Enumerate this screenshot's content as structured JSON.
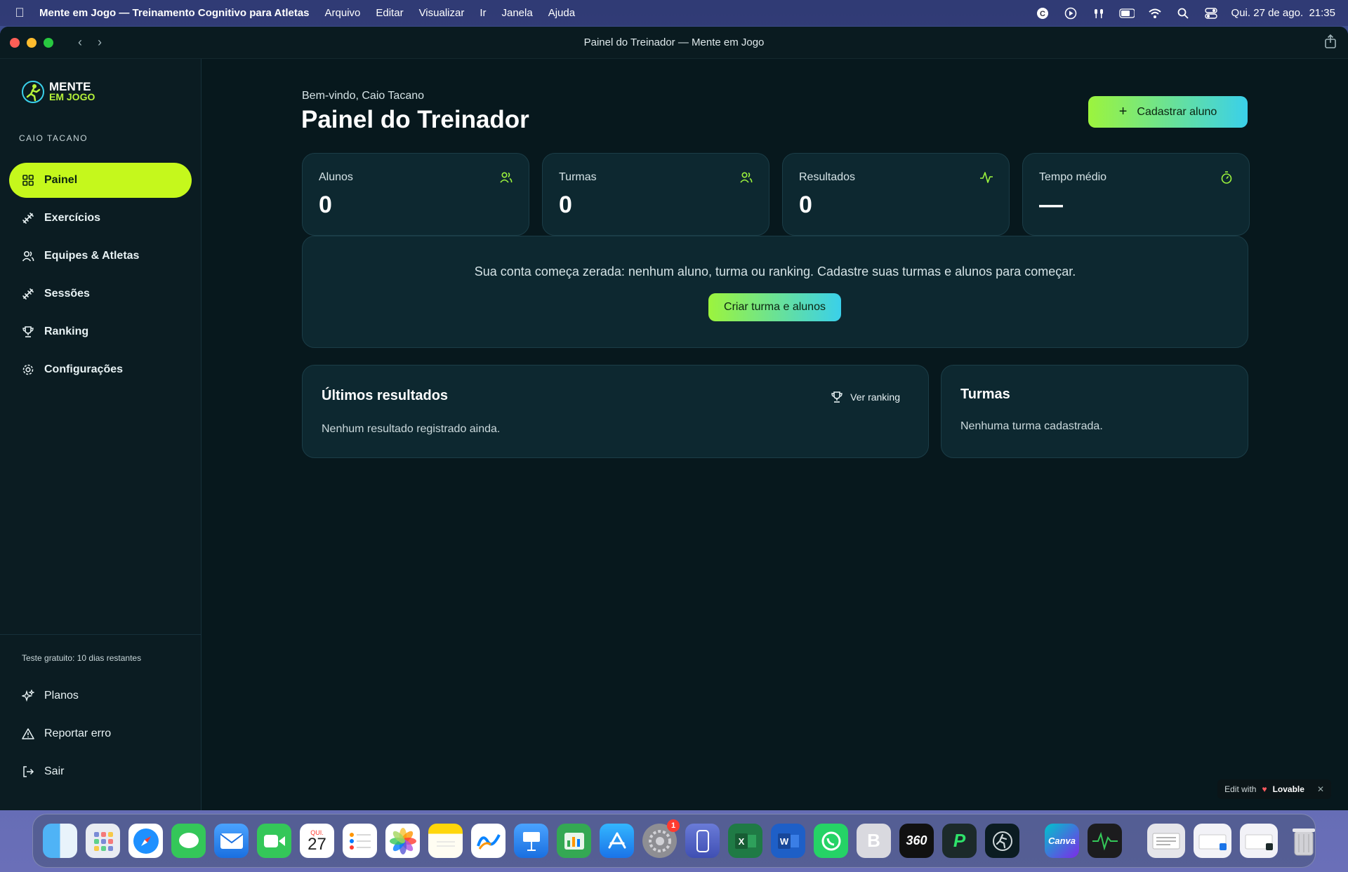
{
  "menubar": {
    "app_name": "Mente em Jogo — Treinamento Cognitivo para Atletas",
    "items": [
      "Arquivo",
      "Editar",
      "Visualizar",
      "Ir",
      "Janela",
      "Ajuda"
    ],
    "datetime": "Qui. 27 de ago.  21:35"
  },
  "window": {
    "title": "Painel do Treinador — Mente em Jogo"
  },
  "sidebar": {
    "brand_top": "MENTE",
    "brand_bottom": "EM JOGO",
    "coach": "CAIO TACANO",
    "items": [
      {
        "label": "Painel",
        "icon": "grid-icon"
      },
      {
        "label": "Exercícios",
        "icon": "dumbbell-icon"
      },
      {
        "label": "Equipes & Atletas",
        "icon": "users-icon"
      },
      {
        "label": "Sessões",
        "icon": "dumbbell-icon"
      },
      {
        "label": "Ranking",
        "icon": "trophy-icon"
      },
      {
        "label": "Configurações",
        "icon": "gear-icon"
      }
    ],
    "trial": "Teste gratuito: 10 dias restantes",
    "bottom_items": [
      {
        "label": "Planos",
        "icon": "sparkles-icon"
      },
      {
        "label": "Reportar erro",
        "icon": "warning-icon"
      },
      {
        "label": "Sair",
        "icon": "logout-icon"
      }
    ]
  },
  "main": {
    "welcome": "Bem-vindo, Caio Tacano",
    "title": "Painel do Treinador",
    "primary_button": "Cadastrar aluno",
    "stats": [
      {
        "label": "Alunos",
        "value": "0"
      },
      {
        "label": "Turmas",
        "value": "0"
      },
      {
        "label": "Resultados",
        "value": "0"
      },
      {
        "label": "Tempo médio",
        "value": "—"
      }
    ],
    "empty_message": "Sua conta começa zerada: nenhum aluno, turma ou ranking. Cadastre suas turmas e alunos para começar.",
    "empty_button": "Criar turma e alunos",
    "results_panel": {
      "title": "Últimos resultados",
      "link": "Ver ranking",
      "empty": "Nenhum resultado registrado ainda."
    },
    "turmas_panel": {
      "title": "Turmas",
      "empty": "Nenhuma turma cadastrada."
    }
  },
  "lovable": {
    "prefix": "Edit with",
    "brand": "Lovable"
  },
  "dock": {
    "calendar_day": "27",
    "calendar_month": "QUI.",
    "settings_badge": "1",
    "apps": [
      "finder",
      "launchpad",
      "safari",
      "messages",
      "mail",
      "facetime",
      "calendar",
      "reminders",
      "photos",
      "notes",
      "freeform",
      "keynote",
      "numbers",
      "app-store",
      "system-settings",
      "iphone-mirroring",
      "excel",
      "word",
      "whatsapp",
      "b-app",
      "360-app",
      "p-app",
      "mente-em-jogo",
      "canva",
      "activity-monitor",
      "downloads-stack",
      "document-stack",
      "screenshot-stack",
      "trash"
    ]
  },
  "colors": {
    "accent": "#c5f81c",
    "gradient_start": "#9cf43d",
    "gradient_end": "#3ad0ea",
    "background": "#07181d",
    "card": "#0d2830"
  }
}
